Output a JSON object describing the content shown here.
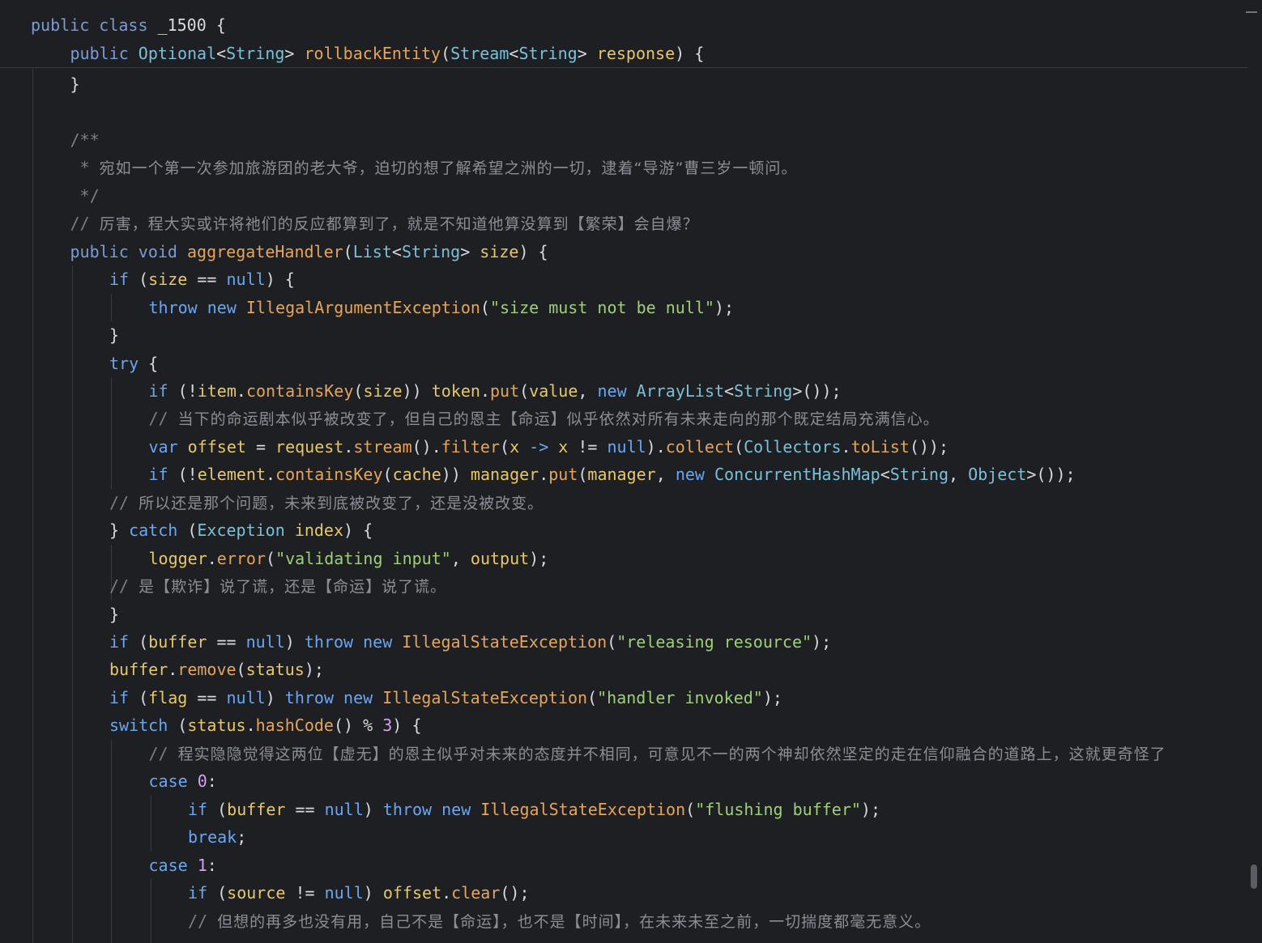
{
  "editor": {
    "sticky": [
      {
        "indent": 0,
        "tokens": [
          {
            "t": "public ",
            "c": "kwp"
          },
          {
            "t": "class ",
            "c": "kwp"
          },
          {
            "t": "_1500 ",
            "c": "plain"
          },
          {
            "t": "{",
            "c": "plain"
          }
        ]
      },
      {
        "indent": 1,
        "tokens": [
          {
            "t": "public ",
            "c": "kwp"
          },
          {
            "t": "Optional",
            "c": "typ"
          },
          {
            "t": "<",
            "c": "plain"
          },
          {
            "t": "String",
            "c": "typ"
          },
          {
            "t": "> ",
            "c": "plain"
          },
          {
            "t": "rollbackEntity",
            "c": "fn"
          },
          {
            "t": "(",
            "c": "plain"
          },
          {
            "t": "Stream",
            "c": "typ"
          },
          {
            "t": "<",
            "c": "plain"
          },
          {
            "t": "String",
            "c": "typ"
          },
          {
            "t": "> ",
            "c": "plain"
          },
          {
            "t": "response",
            "c": "var"
          },
          {
            "t": ") {",
            "c": "plain"
          }
        ]
      }
    ],
    "lines": [
      {
        "indent": 1,
        "tokens": [
          {
            "t": "}",
            "c": "plain"
          }
        ]
      },
      {
        "indent": 0,
        "tokens": []
      },
      {
        "indent": 1,
        "tokens": [
          {
            "t": "/**",
            "c": "cmt"
          }
        ]
      },
      {
        "indent": 1,
        "tokens": [
          {
            "t": " * ",
            "c": "cmt"
          },
          {
            "t": "宛如一个第一次参加旅游团的老大爷，迫切的想了解希望之洲的一切，逮着“导游”曹三岁一顿问。",
            "c": "cmt-zh"
          }
        ]
      },
      {
        "indent": 1,
        "tokens": [
          {
            "t": " */",
            "c": "cmt"
          }
        ]
      },
      {
        "indent": 1,
        "tokens": [
          {
            "t": "// ",
            "c": "cmt"
          },
          {
            "t": "厉害，程大实或许将祂们的反应都算到了，就是不知道他算没算到【繁荣】会自爆？",
            "c": "cmt-zh"
          }
        ]
      },
      {
        "indent": 1,
        "tokens": [
          {
            "t": "public ",
            "c": "kwp"
          },
          {
            "t": "void ",
            "c": "kwp"
          },
          {
            "t": "aggregateHandler",
            "c": "fn"
          },
          {
            "t": "(",
            "c": "plain"
          },
          {
            "t": "List",
            "c": "typ"
          },
          {
            "t": "<",
            "c": "plain"
          },
          {
            "t": "String",
            "c": "typ"
          },
          {
            "t": "> ",
            "c": "plain"
          },
          {
            "t": "size",
            "c": "var"
          },
          {
            "t": ") {",
            "c": "plain"
          }
        ]
      },
      {
        "indent": 2,
        "tokens": [
          {
            "t": "if ",
            "c": "kwb"
          },
          {
            "t": "(",
            "c": "plain"
          },
          {
            "t": "size",
            "c": "var"
          },
          {
            "t": " == ",
            "c": "plain"
          },
          {
            "t": "null",
            "c": "kwb"
          },
          {
            "t": ") {",
            "c": "plain"
          }
        ]
      },
      {
        "indent": 3,
        "tokens": [
          {
            "t": "throw ",
            "c": "kwb"
          },
          {
            "t": "new ",
            "c": "kwb"
          },
          {
            "t": "IllegalArgumentException",
            "c": "fn"
          },
          {
            "t": "(",
            "c": "plain"
          },
          {
            "t": "\"size must not be null\"",
            "c": "str"
          },
          {
            "t": ");",
            "c": "plain"
          }
        ]
      },
      {
        "indent": 2,
        "tokens": [
          {
            "t": "}",
            "c": "plain"
          }
        ]
      },
      {
        "indent": 2,
        "tokens": [
          {
            "t": "try ",
            "c": "kwb"
          },
          {
            "t": "{",
            "c": "plain"
          }
        ]
      },
      {
        "indent": 3,
        "tokens": [
          {
            "t": "if ",
            "c": "kwb"
          },
          {
            "t": "(!",
            "c": "plain"
          },
          {
            "t": "item",
            "c": "var"
          },
          {
            "t": ".",
            "c": "plain"
          },
          {
            "t": "containsKey",
            "c": "fn"
          },
          {
            "t": "(",
            "c": "plain"
          },
          {
            "t": "size",
            "c": "var"
          },
          {
            "t": ")) ",
            "c": "plain"
          },
          {
            "t": "token",
            "c": "var"
          },
          {
            "t": ".",
            "c": "plain"
          },
          {
            "t": "put",
            "c": "fn"
          },
          {
            "t": "(",
            "c": "plain"
          },
          {
            "t": "value",
            "c": "var"
          },
          {
            "t": ", ",
            "c": "plain"
          },
          {
            "t": "new ",
            "c": "kwb"
          },
          {
            "t": "ArrayList",
            "c": "typ"
          },
          {
            "t": "<",
            "c": "plain"
          },
          {
            "t": "String",
            "c": "typ"
          },
          {
            "t": ">());",
            "c": "plain"
          }
        ]
      },
      {
        "indent": 3,
        "tokens": [
          {
            "t": "// ",
            "c": "cmt"
          },
          {
            "t": "当下的命运剧本似乎被改变了，但自己的恩主【命运】似乎依然对所有未来走向的那个既定结局充满信心。",
            "c": "cmt-zh"
          }
        ]
      },
      {
        "indent": 3,
        "tokens": [
          {
            "t": "var ",
            "c": "kwb"
          },
          {
            "t": "offset",
            "c": "var"
          },
          {
            "t": " = ",
            "c": "plain"
          },
          {
            "t": "request",
            "c": "var"
          },
          {
            "t": ".",
            "c": "plain"
          },
          {
            "t": "stream",
            "c": "fn"
          },
          {
            "t": "().",
            "c": "plain"
          },
          {
            "t": "filter",
            "c": "fn"
          },
          {
            "t": "(",
            "c": "plain"
          },
          {
            "t": "x",
            "c": "var"
          },
          {
            "t": " -> ",
            "c": "kwb"
          },
          {
            "t": "x",
            "c": "var"
          },
          {
            "t": " != ",
            "c": "plain"
          },
          {
            "t": "null",
            "c": "kwb"
          },
          {
            "t": ").",
            "c": "plain"
          },
          {
            "t": "collect",
            "c": "fn"
          },
          {
            "t": "(",
            "c": "plain"
          },
          {
            "t": "Collectors",
            "c": "typ"
          },
          {
            "t": ".",
            "c": "plain"
          },
          {
            "t": "toList",
            "c": "fn"
          },
          {
            "t": "());",
            "c": "plain"
          }
        ]
      },
      {
        "indent": 3,
        "tokens": [
          {
            "t": "if ",
            "c": "kwb"
          },
          {
            "t": "(!",
            "c": "plain"
          },
          {
            "t": "element",
            "c": "var"
          },
          {
            "t": ".",
            "c": "plain"
          },
          {
            "t": "containsKey",
            "c": "fn"
          },
          {
            "t": "(",
            "c": "plain"
          },
          {
            "t": "cache",
            "c": "var"
          },
          {
            "t": ")) ",
            "c": "plain"
          },
          {
            "t": "manager",
            "c": "var"
          },
          {
            "t": ".",
            "c": "plain"
          },
          {
            "t": "put",
            "c": "fn"
          },
          {
            "t": "(",
            "c": "plain"
          },
          {
            "t": "manager",
            "c": "var"
          },
          {
            "t": ", ",
            "c": "plain"
          },
          {
            "t": "new ",
            "c": "kwb"
          },
          {
            "t": "ConcurrentHashMap",
            "c": "typ"
          },
          {
            "t": "<",
            "c": "plain"
          },
          {
            "t": "String",
            "c": "typ"
          },
          {
            "t": ", ",
            "c": "plain"
          },
          {
            "t": "Object",
            "c": "typ"
          },
          {
            "t": ">());",
            "c": "plain"
          }
        ]
      },
      {
        "indent": 2,
        "tokens": [
          {
            "t": "// ",
            "c": "cmt"
          },
          {
            "t": "所以还是那个问题，未来到底被改变了，还是没被改变。",
            "c": "cmt-zh"
          }
        ]
      },
      {
        "indent": 2,
        "tokens": [
          {
            "t": "} ",
            "c": "plain"
          },
          {
            "t": "catch ",
            "c": "kwb"
          },
          {
            "t": "(",
            "c": "plain"
          },
          {
            "t": "Exception ",
            "c": "typ"
          },
          {
            "t": "index",
            "c": "var"
          },
          {
            "t": ") {",
            "c": "plain"
          }
        ]
      },
      {
        "indent": 3,
        "tokens": [
          {
            "t": "logger",
            "c": "var"
          },
          {
            "t": ".",
            "c": "plain"
          },
          {
            "t": "error",
            "c": "fn"
          },
          {
            "t": "(",
            "c": "plain"
          },
          {
            "t": "\"validating input\"",
            "c": "str"
          },
          {
            "t": ", ",
            "c": "plain"
          },
          {
            "t": "output",
            "c": "var"
          },
          {
            "t": ");",
            "c": "plain"
          }
        ]
      },
      {
        "indent": 2,
        "tokens": [
          {
            "t": "// ",
            "c": "cmt"
          },
          {
            "t": "是【欺诈】说了谎，还是【命运】说了谎。",
            "c": "cmt-zh"
          }
        ]
      },
      {
        "indent": 2,
        "tokens": [
          {
            "t": "}",
            "c": "plain"
          }
        ]
      },
      {
        "indent": 2,
        "tokens": [
          {
            "t": "if ",
            "c": "kwb"
          },
          {
            "t": "(",
            "c": "plain"
          },
          {
            "t": "buffer",
            "c": "var"
          },
          {
            "t": " == ",
            "c": "plain"
          },
          {
            "t": "null",
            "c": "kwb"
          },
          {
            "t": ") ",
            "c": "plain"
          },
          {
            "t": "throw ",
            "c": "kwb"
          },
          {
            "t": "new ",
            "c": "kwb"
          },
          {
            "t": "IllegalStateException",
            "c": "fn"
          },
          {
            "t": "(",
            "c": "plain"
          },
          {
            "t": "\"releasing resource\"",
            "c": "str"
          },
          {
            "t": ");",
            "c": "plain"
          }
        ]
      },
      {
        "indent": 2,
        "tokens": [
          {
            "t": "buffer",
            "c": "var"
          },
          {
            "t": ".",
            "c": "plain"
          },
          {
            "t": "remove",
            "c": "fn"
          },
          {
            "t": "(",
            "c": "plain"
          },
          {
            "t": "status",
            "c": "var"
          },
          {
            "t": ");",
            "c": "plain"
          }
        ]
      },
      {
        "indent": 2,
        "tokens": [
          {
            "t": "if ",
            "c": "kwb"
          },
          {
            "t": "(",
            "c": "plain"
          },
          {
            "t": "flag",
            "c": "var"
          },
          {
            "t": " == ",
            "c": "plain"
          },
          {
            "t": "null",
            "c": "kwb"
          },
          {
            "t": ") ",
            "c": "plain"
          },
          {
            "t": "throw ",
            "c": "kwb"
          },
          {
            "t": "new ",
            "c": "kwb"
          },
          {
            "t": "IllegalStateException",
            "c": "fn"
          },
          {
            "t": "(",
            "c": "plain"
          },
          {
            "t": "\"handler invoked\"",
            "c": "str"
          },
          {
            "t": ");",
            "c": "plain"
          }
        ]
      },
      {
        "indent": 2,
        "tokens": [
          {
            "t": "switch ",
            "c": "kwb"
          },
          {
            "t": "(",
            "c": "plain"
          },
          {
            "t": "status",
            "c": "var"
          },
          {
            "t": ".",
            "c": "plain"
          },
          {
            "t": "hashCode",
            "c": "fn"
          },
          {
            "t": "() % ",
            "c": "plain"
          },
          {
            "t": "3",
            "c": "num"
          },
          {
            "t": ") {",
            "c": "plain"
          }
        ]
      },
      {
        "indent": 3,
        "tokens": [
          {
            "t": "// ",
            "c": "cmt"
          },
          {
            "t": "程实隐隐觉得这两位【虚无】的恩主似乎对未来的态度并不相同，可意见不一的两个神却依然坚定的走在信仰融合的道路上，这就更奇怪了",
            "c": "cmt-zh"
          }
        ]
      },
      {
        "indent": 3,
        "tokens": [
          {
            "t": "case ",
            "c": "kwb"
          },
          {
            "t": "0",
            "c": "num"
          },
          {
            "t": ":",
            "c": "plain"
          }
        ]
      },
      {
        "indent": 4,
        "tokens": [
          {
            "t": "if ",
            "c": "kwb"
          },
          {
            "t": "(",
            "c": "plain"
          },
          {
            "t": "buffer",
            "c": "var"
          },
          {
            "t": " == ",
            "c": "plain"
          },
          {
            "t": "null",
            "c": "kwb"
          },
          {
            "t": ") ",
            "c": "plain"
          },
          {
            "t": "throw ",
            "c": "kwb"
          },
          {
            "t": "new ",
            "c": "kwb"
          },
          {
            "t": "IllegalStateException",
            "c": "fn"
          },
          {
            "t": "(",
            "c": "plain"
          },
          {
            "t": "\"flushing buffer\"",
            "c": "str"
          },
          {
            "t": ");",
            "c": "plain"
          }
        ]
      },
      {
        "indent": 4,
        "tokens": [
          {
            "t": "break",
            "c": "kwb"
          },
          {
            "t": ";",
            "c": "plain"
          }
        ]
      },
      {
        "indent": 3,
        "tokens": [
          {
            "t": "case ",
            "c": "kwb"
          },
          {
            "t": "1",
            "c": "num"
          },
          {
            "t": ":",
            "c": "plain"
          }
        ]
      },
      {
        "indent": 4,
        "tokens": [
          {
            "t": "if ",
            "c": "kwb"
          },
          {
            "t": "(",
            "c": "plain"
          },
          {
            "t": "source",
            "c": "var"
          },
          {
            "t": " != ",
            "c": "plain"
          },
          {
            "t": "null",
            "c": "kwb"
          },
          {
            "t": ") ",
            "c": "plain"
          },
          {
            "t": "offset",
            "c": "var"
          },
          {
            "t": ".",
            "c": "plain"
          },
          {
            "t": "clear",
            "c": "fn"
          },
          {
            "t": "();",
            "c": "plain"
          }
        ]
      },
      {
        "indent": 4,
        "tokens": [
          {
            "t": "// ",
            "c": "cmt"
          },
          {
            "t": "但想的再多也没有用，自己不是【命运】，也不是【时间】，在未来未至之前，一切揣度都毫无意义。",
            "c": "cmt-zh"
          }
        ]
      }
    ]
  }
}
